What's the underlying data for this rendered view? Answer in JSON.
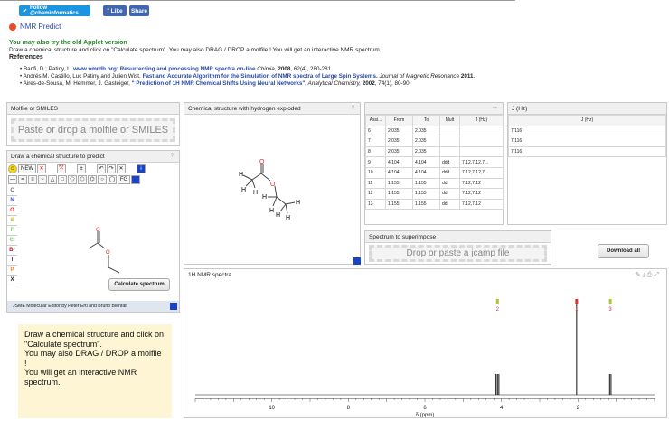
{
  "social": {
    "twitter_label": "Follow @cheminformatics",
    "fb_like": "Like",
    "fb_share": "Share"
  },
  "title": "NMR Predict",
  "intro": {
    "applet_link": "You may also try the old Applet version",
    "instructions": "Draw a chemical structure and click on \"Calculate spectrum\". You may also DRAG / DROP a molfile ! You will get an interactive NMR spectrum.",
    "references_label": "References"
  },
  "references": [
    {
      "authors": "Banfi, D.; Patiny, L.",
      "link": "www.nmrdb.org: Resurrecting and processing NMR spectra on-line",
      "journal": "Chimia,",
      "year": "2008",
      "rest": ", 62(4), 280-281."
    },
    {
      "authors": "Andrés M. Castillo, Luc Patiny and Julien Wist.",
      "link": "Fast and Accurate Algorithm for the Simulation of NMR spectra of Large Spin Systems.",
      "journal": "Journal of Magnetic Resonance",
      "year": "2011",
      "rest": "."
    },
    {
      "authors": "Aires-de-Sousa, M. Hemmer, J. Gasteiger,",
      "link": "\" Prediction of 1H NMR Chemical Shifts Using Neural Networks\"",
      "journal": ", Analytical Chemistry,",
      "year": "2002",
      "rest": ", 74(1), 80-90."
    }
  ],
  "molfile_panel": {
    "title": "Molfile or SMILES",
    "drop_text": "Paste or drop a molfile or SMILES"
  },
  "draw_panel": {
    "title": "Draw a chemical structure to predict",
    "help": "?",
    "new_label": "NEW",
    "fg_label": "FG",
    "rail": [
      "C",
      "N",
      "O",
      "S",
      "F",
      "Cl",
      "Br",
      "I",
      "P",
      "X"
    ],
    "rail_colors": [
      "#777777",
      "#3050f8",
      "#ff2020",
      "#c8c800",
      "#70d070",
      "#70d070",
      "#a62929",
      "#940094",
      "#ff8000",
      "#222222"
    ],
    "calc_button": "Calculate spectrum",
    "footer": "JSME Molecular Editor by Peter Ertl and Bruno Bienfait"
  },
  "hydrogen_panel": {
    "title": "Chemical structure with hydrogen exploded",
    "help": "?"
  },
  "assign_table": {
    "headers": [
      "Assi...",
      "From",
      "To",
      "Mult",
      "J (Hz)"
    ],
    "rows": [
      [
        "6",
        "2.035",
        "2.035",
        "",
        ""
      ],
      [
        "7",
        "2.035",
        "2.035",
        "",
        ""
      ],
      [
        "8",
        "2.035",
        "2.035",
        "",
        ""
      ],
      [
        "9",
        "4.104",
        "4.104",
        "ddd",
        "7.12,7.12,7..."
      ],
      [
        "10",
        "4.104",
        "4.104",
        "ddd",
        "7.12,7.12,7..."
      ],
      [
        "11",
        "1.155",
        "1.155",
        "dd",
        "7.12,7.12"
      ],
      [
        "12",
        "1.155",
        "1.155",
        "dd",
        "7.12,7.12"
      ],
      [
        "13",
        "1.155",
        "1.155",
        "dd",
        "7.12,7.12"
      ]
    ]
  },
  "j_panel": {
    "title": "J (Hz)",
    "header": "J (Hz)",
    "values": [
      "7.116",
      "7.116",
      "7.116"
    ]
  },
  "superimpose": {
    "title": "Spectrum to superimpose",
    "drop_text": "Drop or paste a jcamp file"
  },
  "download_button": "Download all",
  "spectrum": {
    "title": "1H NMR spectra",
    "x_axis_label": "δ (ppm)",
    "tick_labels": [
      "10",
      "8",
      "6",
      "4",
      "2"
    ],
    "peak_labels": [
      "2",
      "1",
      "3"
    ],
    "peak_label_colors": [
      "#e03030",
      "#e03030",
      "#e03030"
    ]
  },
  "chart_data": {
    "type": "line",
    "x_ticks": [
      10,
      8,
      6,
      4,
      2
    ],
    "xlim": [
      12,
      0
    ],
    "peaks": [
      {
        "label": "2",
        "shift": 4.104,
        "relative_height": 0.23,
        "multiplicity": "ddd"
      },
      {
        "label": "1",
        "shift": 2.035,
        "relative_height": 1.0,
        "multiplicity": "s"
      },
      {
        "label": "3",
        "shift": 1.155,
        "relative_height": 0.23,
        "multiplicity": "dd"
      }
    ],
    "xlabel": "δ (ppm)"
  },
  "note": {
    "lines": [
      "Draw a chemical structure and click on",
      "\"Calculate spectrum\".",
      "You may also DRAG / DROP a molfile",
      "!",
      "You will get an interactive NMR",
      "spectrum."
    ]
  }
}
